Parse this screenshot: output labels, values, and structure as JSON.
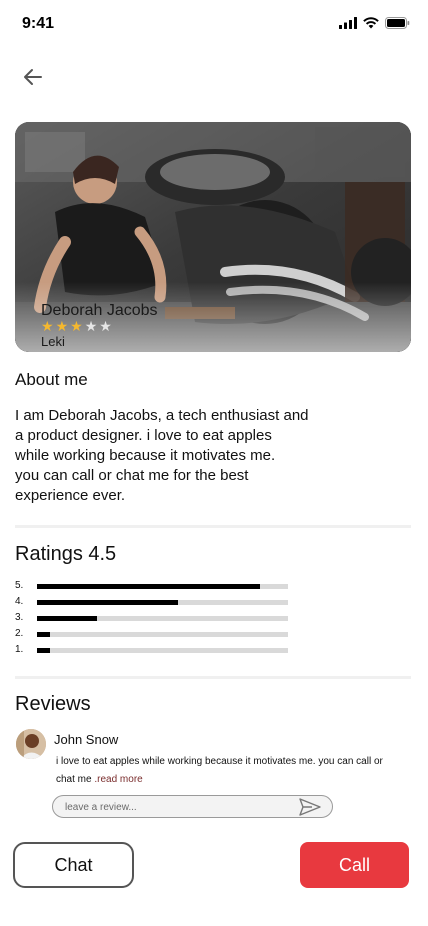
{
  "status_bar": {
    "time": "9:41",
    "icons": [
      "signal-icon",
      "wifi-icon",
      "battery-icon"
    ]
  },
  "nav": {
    "back_icon": "arrow-left-icon"
  },
  "profile": {
    "name": "Deborah Jacobs",
    "rating_stars": 3,
    "max_stars": 5,
    "location": "Leki",
    "photo_description_icon": "profile-photo"
  },
  "about": {
    "title": "About me",
    "text": "I am  Deborah Jacobs, a tech enthusiast and\na product designer. i love to eat apples\nwhile working because it motivates me.\nyou can call or chat me for the best\nexperience ever."
  },
  "ratings": {
    "title": "Ratings 4.5",
    "rows": [
      {
        "label": "5.",
        "fraction": 0.89
      },
      {
        "label": "4.",
        "fraction": 0.56
      },
      {
        "label": "3.",
        "fraction": 0.24
      },
      {
        "label": "2.",
        "fraction": 0.05
      },
      {
        "label": "1.",
        "fraction": 0.05
      }
    ]
  },
  "reviews": {
    "title": "Reviews",
    "items": [
      {
        "name": "John Snow",
        "text": "i love to eat apples while working because it motivates me. you can call or chat me ",
        "read_more": ".read more"
      }
    ],
    "input_placeholder": "leave a review...",
    "send_icon": "send-icon"
  },
  "actions": {
    "chat_label": "Chat",
    "call_label": "Call"
  },
  "colors": {
    "accent": "#e8393f",
    "star": "#f5b82e",
    "star_empty": "#e6e6e6",
    "rating_fill": "#000000",
    "rating_track": "#d9d9d9",
    "read_more": "#7a2d2d"
  }
}
